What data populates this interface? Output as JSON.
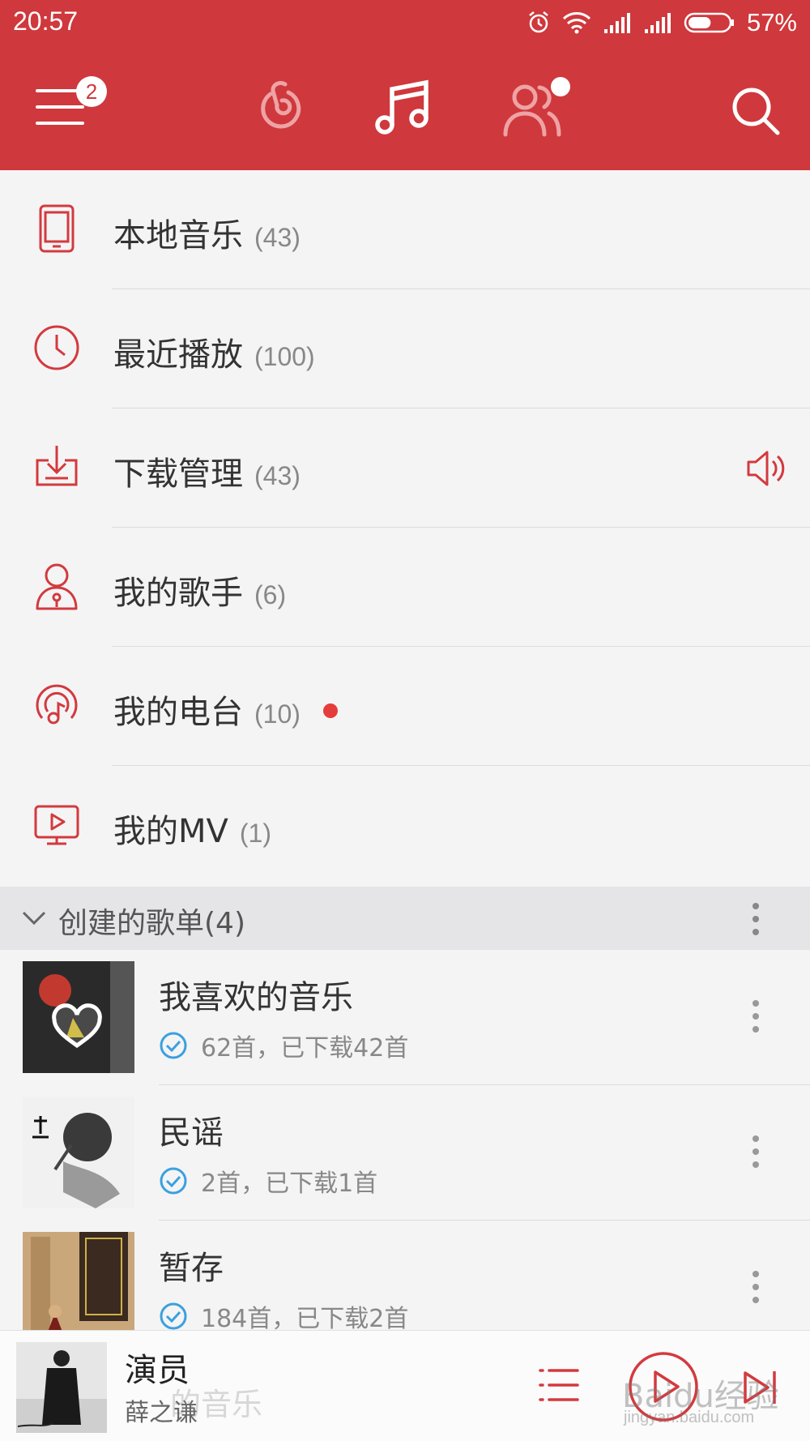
{
  "status_bar": {
    "time": "20:57",
    "battery_percent": "57%",
    "battery_level": 0.57
  },
  "header": {
    "menu_badge": "2",
    "active_tab": "music",
    "accent_color": "#cf383c"
  },
  "menu": [
    {
      "label": "本地音乐",
      "count": "(43)",
      "icon": "tablet-icon"
    },
    {
      "label": "最近播放",
      "count": "(100)",
      "icon": "clock-icon"
    },
    {
      "label": "下载管理",
      "count": "(43)",
      "icon": "download-icon"
    },
    {
      "label": "我的歌手",
      "count": "(6)",
      "icon": "singer-icon"
    },
    {
      "label": "我的电台",
      "count": "(10)",
      "icon": "radio-icon"
    },
    {
      "label": "我的MV",
      "count": "(1)",
      "icon": "mv-icon"
    }
  ],
  "created_playlists": {
    "title": "创建的歌单(4)",
    "items": [
      {
        "name": "我喜欢的音乐",
        "meta": "62首，已下载42首"
      },
      {
        "name": "民谣",
        "meta": "2首，已下载1首"
      },
      {
        "name": "暂存",
        "meta": "184首，已下载2首"
      }
    ]
  },
  "player": {
    "song": "演员",
    "artist": "薛之谦",
    "overlay_text": "的音乐",
    "watermark": "Baidu经验",
    "watermark_url": "jingyan.baidu.com"
  }
}
